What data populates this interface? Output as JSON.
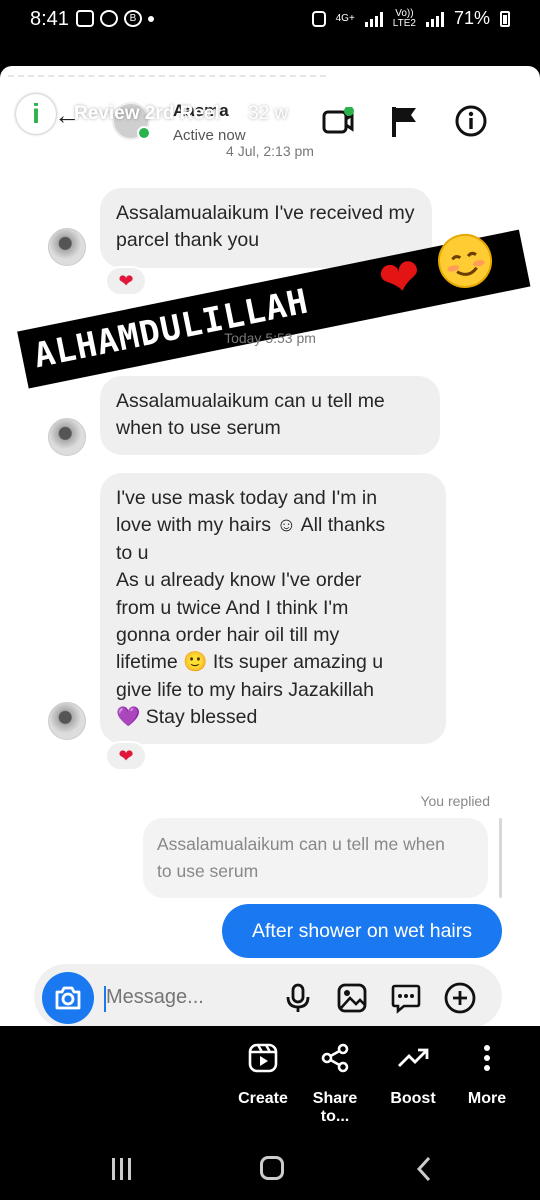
{
  "status_bar": {
    "time": "8:41",
    "battery": "71%",
    "net_type": "4G+",
    "volte_top": "Vo))",
    "volte_bottom": "LTE2"
  },
  "chat": {
    "contact_name": "Aasma",
    "contact_status": "Active now",
    "reel_title": "Review 2rd Reel",
    "reel_age": "32 w"
  },
  "overlay": {
    "banner_text": "ALHAMDULILLAH",
    "banner_emoji_heart": "❤",
    "banner_emoji_smile": "☺"
  },
  "messages": {
    "date1": "4 Jul, 2:13 pm",
    "msg1": "Assalamualaikum I've received my parcel thank you",
    "date2": "Today 5:53 pm",
    "msg2_line1": "Assalamualaikum can u tell me",
    "msg2_line2": "when to use serum",
    "msg3_lines": [
      "I've use mask today and I'm in",
      "love with my hairs ☺ All thanks",
      "to u",
      "As u already know I've order",
      "from u twice And I think I'm",
      "gonna order hair oil till my",
      "lifetime 🙂 Its super amazing u",
      "give life to my hairs Jazakillah",
      "💜 Stay blessed"
    ],
    "reaction": "❤",
    "replied_label": "You replied",
    "quoted_line1": "Assalamualaikum can u tell me when",
    "quoted_line2": "to use serum",
    "reply": "After shower on wet hairs"
  },
  "composer": {
    "placeholder": "Message..."
  },
  "actions": [
    {
      "label": "Create",
      "icon": "reel-create-icon"
    },
    {
      "label": "Share to...",
      "icon": "share-icon"
    },
    {
      "label": "Boost",
      "icon": "trending-up-icon"
    },
    {
      "label": "More",
      "icon": "more-vertical-icon"
    }
  ],
  "colors": {
    "accent": "#1a79f0",
    "online": "#2bb24c",
    "bubble_in": "#efefef"
  }
}
